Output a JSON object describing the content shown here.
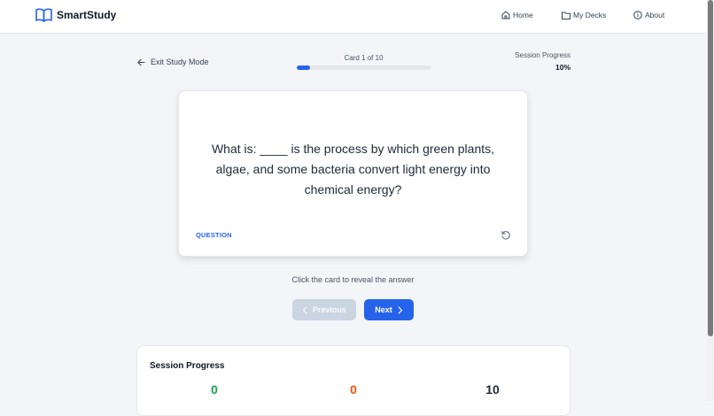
{
  "header": {
    "brand": "SmartStudy",
    "nav": [
      {
        "label": "Home",
        "icon": "home-icon"
      },
      {
        "label": "My Decks",
        "icon": "folder-icon"
      },
      {
        "label": "About",
        "icon": "info-icon"
      }
    ]
  },
  "study": {
    "exit_label": "Exit Study Mode",
    "card_counter": "Card 1 of 10",
    "card_progress": 0.1,
    "session_label": "Session Progress",
    "session_value": "10%"
  },
  "card": {
    "question": "What is: ____ is the process by which green plants, algae, and some bacteria convert light energy into chemical energy?",
    "type_label": "QUESTION"
  },
  "hint": "Click the card to reveal the answer",
  "buttons": {
    "previous": "Previous",
    "next": "Next"
  },
  "session_panel": {
    "title": "Session Progress",
    "stats": [
      {
        "value": "0",
        "color": "#16a34a"
      },
      {
        "value": "0",
        "color": "#ea580c"
      },
      {
        "value": "10",
        "color": "#1f2937"
      }
    ]
  },
  "colors": {
    "accent": "#2563eb",
    "background": "#f3f5f9"
  }
}
